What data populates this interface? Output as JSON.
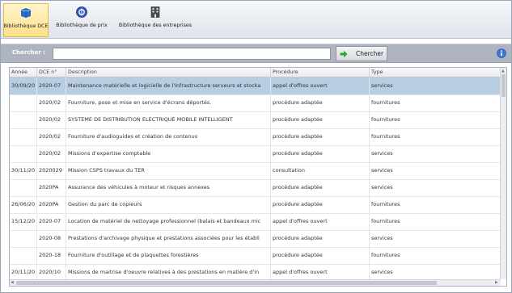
{
  "ribbon": {
    "tabs": [
      {
        "label": "Bibliothèque DCE",
        "icon": "books-icon",
        "active": true
      },
      {
        "label": "Bibliothèque de prix",
        "icon": "price-library-icon",
        "active": false
      },
      {
        "label": "Bibliothèque des entreprises",
        "icon": "building-icon",
        "active": false
      }
    ]
  },
  "search": {
    "label": "Chercher :",
    "value": "",
    "button_label": "Chercher"
  },
  "table": {
    "headers": [
      "Année",
      "DCE n°",
      "Description",
      "Procédure",
      "Type"
    ],
    "rows": [
      {
        "annee": "30/09/20",
        "dce": "2020-07",
        "description": "Maintenance matérielle et logicielle de l'infrastructure serveurs et stocka",
        "procedure": "appel d'offres ouvert",
        "type": "services"
      },
      {
        "annee": "",
        "dce": "2020/02",
        "description": "Fourniture, pose et mise en service d'écrans déportés.",
        "procedure": "procédure adaptée",
        "type": "fournitures"
      },
      {
        "annee": "",
        "dce": "2020/02",
        "description": "SYSTEME DE DISTRIBUTION ELECTRIQUE MOBILE INTELLIGENT",
        "procedure": "procédure adaptée",
        "type": "fournitures"
      },
      {
        "annee": "",
        "dce": "2020/02",
        "description": "Fourniture d'audioguides et création de contenus",
        "procedure": "procédure adaptée",
        "type": "fournitures"
      },
      {
        "annee": "",
        "dce": "2020/02",
        "description": "Missions d'expertise comptable",
        "procedure": "procédure adaptée",
        "type": "services"
      },
      {
        "annee": "30/11/20",
        "dce": "2020029",
        "description": "Mission CSPS travaux du TER",
        "procedure": "consultation",
        "type": "services"
      },
      {
        "annee": "",
        "dce": "2020PA",
        "description": "Assurance des véhicules à moteur et risques annexes",
        "procedure": "procédure adaptée",
        "type": "services"
      },
      {
        "annee": "26/06/20",
        "dce": "2020PA",
        "description": "Gestion du parc de copieurs",
        "procedure": "procédure adaptée",
        "type": "fournitures"
      },
      {
        "annee": "15/12/20",
        "dce": "2020-07",
        "description": "Location de matériel de nettoyage professionnel (balais et bandeaux mic",
        "procedure": "appel d'offres ouvert",
        "type": "fournitures"
      },
      {
        "annee": "",
        "dce": "2020-08",
        "description": "Prestations d'archivage physique et prestations associées pour les établi",
        "procedure": "procédure adaptée",
        "type": "services"
      },
      {
        "annee": "",
        "dce": "2020-18",
        "description": "Fourniture d'outillage et de plaquettes forestières",
        "procedure": "procédure adaptée",
        "type": "fournitures"
      },
      {
        "annee": "20/11/20",
        "dce": "2020/10",
        "description": "Missions de maitrise d'oeuvre relatives à des prestations en matière d'in",
        "procedure": "appel d'offres ouvert",
        "type": "services"
      }
    ],
    "selected_row": 0
  },
  "colors": {
    "selected_row": "#b8cde2",
    "active_tab": "#ffe08a",
    "search_bar": "#aeb5c1",
    "search_arrow": "#2aa62a",
    "info_icon": "#3b78d8"
  }
}
